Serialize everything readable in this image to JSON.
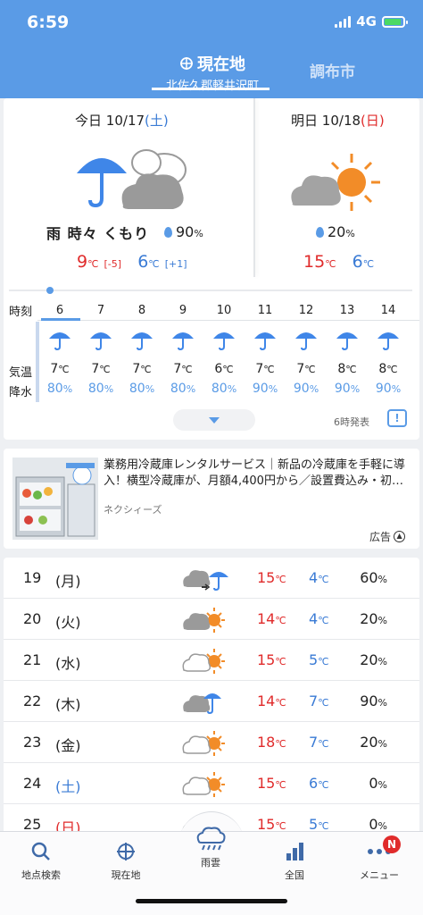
{
  "status_bar": {
    "time": "6:59",
    "network": "4G"
  },
  "header": {
    "tab_current_title": "現在地",
    "tab_current_subtitle": "北佐久郡軽井沢町",
    "tab_other": "調布市"
  },
  "today": {
    "title": "今日",
    "date": "10/17",
    "dow": "(土)",
    "condition": "雨 時々 くもり",
    "pop": "90",
    "pop_unit": "%",
    "high": "9",
    "high_diff": "[-5]",
    "low": "6",
    "low_diff": "[+1]",
    "deg": "℃"
  },
  "tomorrow": {
    "title": "明日",
    "date": "10/18",
    "dow": "(日)",
    "pop": "20",
    "pop_unit": "%",
    "high": "15",
    "low": "6",
    "deg": "℃"
  },
  "hourly": {
    "labels": {
      "hour": "時刻",
      "temp": "気温",
      "precip": "降水"
    },
    "hours": [
      {
        "h": "6",
        "t": "7",
        "p": "80"
      },
      {
        "h": "7",
        "t": "7",
        "p": "80"
      },
      {
        "h": "8",
        "t": "7",
        "p": "80"
      },
      {
        "h": "9",
        "t": "7",
        "p": "80"
      },
      {
        "h": "10",
        "t": "6",
        "p": "80"
      },
      {
        "h": "11",
        "t": "7",
        "p": "90"
      },
      {
        "h": "12",
        "t": "7",
        "p": "90"
      },
      {
        "h": "13",
        "t": "8",
        "p": "90"
      },
      {
        "h": "14",
        "t": "8",
        "p": "90"
      }
    ],
    "deg": "℃",
    "pct": "%",
    "published": "6時発表"
  },
  "ad": {
    "text": "業務用冷蔵庫レンタルサービス｜新品の冷蔵庫を手軽に導入！横型冷蔵庫が、月額4,400円から／設置費込み・初…",
    "sponsor": "ネクシィーズ",
    "label": "広告"
  },
  "weekly": [
    {
      "date": "19",
      "dow": "(月)",
      "dow_color": "#222",
      "icon": "cloud-to-rain-icon",
      "hi": "15",
      "lo": "4",
      "pop": "60"
    },
    {
      "date": "20",
      "dow": "(火)",
      "dow_color": "#222",
      "icon": "cloud-sun-icon",
      "hi": "14",
      "lo": "4",
      "pop": "20"
    },
    {
      "date": "21",
      "dow": "(水)",
      "dow_color": "#222",
      "icon": "cloud-sun-light-icon",
      "hi": "15",
      "lo": "5",
      "pop": "20"
    },
    {
      "date": "22",
      "dow": "(木)",
      "dow_color": "#222",
      "icon": "cloud-rain-icon",
      "hi": "14",
      "lo": "7",
      "pop": "90"
    },
    {
      "date": "23",
      "dow": "(金)",
      "dow_color": "#222",
      "icon": "cloud-sun-light-icon",
      "hi": "18",
      "lo": "7",
      "pop": "20"
    },
    {
      "date": "24",
      "dow": "(土)",
      "dow_color": "#3a7bd5",
      "icon": "cloud-sun-light-icon",
      "hi": "15",
      "lo": "6",
      "pop": "0"
    },
    {
      "date": "25",
      "dow": "(日)",
      "dow_color": "#e02b2b",
      "icon": "cloud-sun-light-icon",
      "hi": "15",
      "lo": "5",
      "pop": "0"
    }
  ],
  "weekly_units": {
    "deg": "℃",
    "pct": "%"
  },
  "bottom_nav": [
    {
      "label": "地点検索",
      "icon": "search-icon"
    },
    {
      "label": "現在地",
      "icon": "location-target-icon"
    },
    {
      "label": "雨雲",
      "icon": "rain-cloud-icon"
    },
    {
      "label": "全国",
      "icon": "map-bars-icon"
    },
    {
      "label": "メニュー",
      "icon": "more-dots-icon",
      "badge": "N"
    }
  ],
  "colors": {
    "header": "#5a9be6",
    "rain_blue": "#3a7bd5",
    "hot_red": "#e02b2b",
    "sun_orange": "#f28c28"
  }
}
